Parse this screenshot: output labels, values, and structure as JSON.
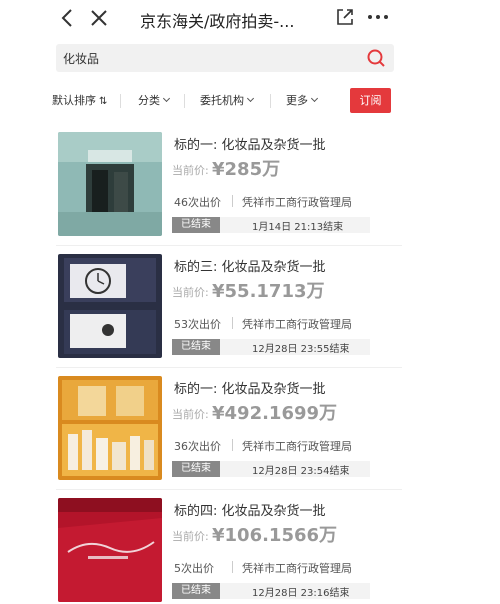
{
  "nav": {
    "title": "京东海关/政府拍卖-...",
    "icons": [
      "back-icon",
      "close-icon",
      "share-icon",
      "more-icon"
    ]
  },
  "search": {
    "query": "化妆品"
  },
  "filters": {
    "sort": "默认排序",
    "category": "分类",
    "agency": "委托机构",
    "more": "更多",
    "subscribe": "订阅"
  },
  "colors": {
    "accent": "#e4393c",
    "ended_badge": "#888888"
  },
  "items": [
    {
      "title": "标的一: 化妆品及杂货一批",
      "price_label": "当前价:",
      "price": "¥285万",
      "bids": "46次出价",
      "org": "凭祥市工商行政管理局",
      "status": "已结束",
      "end_time": "1月14日 21:13结束"
    },
    {
      "title": "标的三: 化妆品及杂货一批",
      "price_label": "当前价:",
      "price": "¥55.1713万",
      "bids": "53次出价",
      "org": "凭祥市工商行政管理局",
      "status": "已结束",
      "end_time": "12月28日 23:55结束"
    },
    {
      "title": "标的一: 化妆品及杂货一批",
      "price_label": "当前价:",
      "price": "¥492.1699万",
      "bids": "36次出价",
      "org": "凭祥市工商行政管理局",
      "status": "已结束",
      "end_time": "12月28日 23:54结束"
    },
    {
      "title": "标的四: 化妆品及杂货一批",
      "price_label": "当前价:",
      "price": "¥106.1566万",
      "bids": "5次出价",
      "org": "凭祥市工商行政管理局",
      "status": "已结束",
      "end_time": "12月28日 23:16结束"
    }
  ]
}
